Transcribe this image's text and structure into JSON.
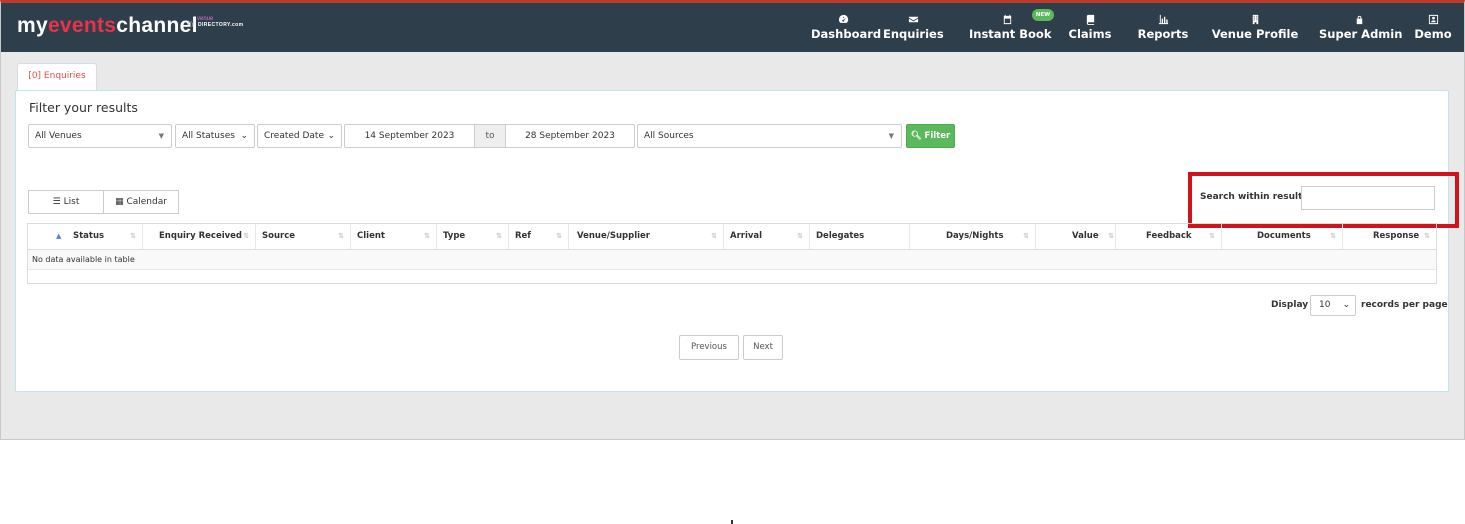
{
  "header": {
    "brand_prefix": "my",
    "brand_accent": "events",
    "brand_suffix": "channel",
    "brand_by": "by",
    "brand_venue": "venue",
    "brand_directory": "DIRECTORY.com",
    "nav": [
      {
        "label": "Dashboard",
        "icon": "tachometer-icon"
      },
      {
        "label": "Enquiries",
        "icon": "envelope-icon"
      },
      {
        "label": "Instant Book",
        "icon": "calendar-icon",
        "badge": "NEW"
      },
      {
        "label": "Claims",
        "icon": "book-icon"
      },
      {
        "label": "Reports",
        "icon": "bar-chart-icon"
      },
      {
        "label": "Venue Profile",
        "icon": "building-icon"
      },
      {
        "label": "Super Admin",
        "icon": "lock-icon"
      },
      {
        "label": "Demo",
        "icon": "user-icon"
      }
    ]
  },
  "tab": {
    "label": "[0] Enquiries"
  },
  "filter": {
    "title": "Filter your results",
    "venues": "All Venues",
    "statuses": "All Statuses",
    "date_type": "Created Date",
    "date_from": "14 September 2023",
    "to_label": "to",
    "date_to": "28 September 2023",
    "sources": "All Sources",
    "filter_button": "Filter"
  },
  "view": {
    "list": "List",
    "calendar": "Calendar"
  },
  "search": {
    "label": "Search within results",
    "value": ""
  },
  "table": {
    "columns": [
      "Status",
      "Enquiry Received",
      "Source",
      "Client",
      "Type",
      "Ref",
      "Venue/Supplier",
      "Arrival",
      "Delegates",
      "Days/Nights",
      "Value",
      "Feedback",
      "Documents",
      "Response"
    ],
    "empty_text": "No data available in table"
  },
  "display": {
    "prefix": "Display",
    "count": "10",
    "suffix": "records per page"
  },
  "pagination": {
    "previous": "Previous",
    "next": "Next"
  },
  "colors": {
    "topbar": "#2f3e4b",
    "accent": "#e8334a",
    "filter_green": "#5cb85c",
    "highlight": "#d1141b"
  }
}
